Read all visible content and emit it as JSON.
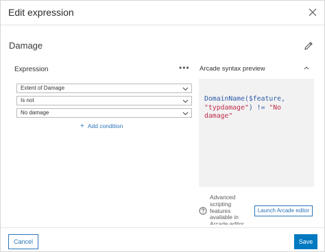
{
  "dialog": {
    "title": "Edit expression",
    "close_icon": "close-icon"
  },
  "expression_name": {
    "value": "Damage",
    "edit_icon": "pencil-icon"
  },
  "expression_panel": {
    "label": "Expression",
    "more_icon": "ellipsis-icon",
    "field_select": {
      "value": "Extent of Damage"
    },
    "operator_select": {
      "value": "Is not"
    },
    "value_select": {
      "value": "No damage"
    },
    "add_condition": "Add condition"
  },
  "preview": {
    "title": "Arcade syntax preview",
    "collapse_icon": "chevron-up-icon",
    "code": {
      "line1_fn": "DomainName($feature,",
      "line2_str": "\"typdamage\"",
      "line2_rest": ") != ",
      "line2_str2": "\"No",
      "line3_str": "damage\""
    }
  },
  "arcade_editor": {
    "help_icon": "question-circle-icon",
    "help_text": "Advanced scripting features available in Arcade editor",
    "launch_label": "Launch Arcade editor"
  },
  "footer": {
    "cancel_label": "Cancel",
    "save_label": "Save"
  },
  "colors": {
    "accent": "#0079c1",
    "link": "#2a73b7",
    "code_keyword": "#2b5aa9",
    "code_string": "#c22d4c"
  }
}
